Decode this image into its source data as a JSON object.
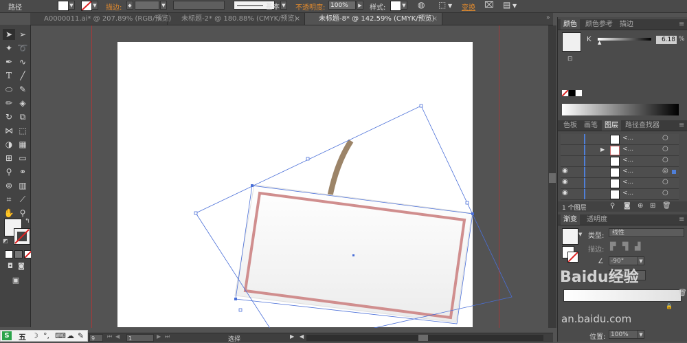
{
  "control_bar": {
    "object_type": "路径",
    "stroke_label": "描边:",
    "stroke_profile": "基本",
    "opacity_label": "不透明度:",
    "opacity_value": "100%",
    "style_label": "样式:",
    "transform_label": "变换"
  },
  "tabs": [
    {
      "label": "A0000011.ai* @ 207.89% (RGB/预览)",
      "close": "×"
    },
    {
      "label": "未标题-2* @ 180.88% (CMYK/预览)",
      "close": "×"
    },
    {
      "label": "未标题-8* @ 142.59% (CMYK/预览)",
      "close": "×"
    }
  ],
  "color_panel": {
    "tabs": [
      "颜色",
      "颜色参考",
      "描边"
    ],
    "channel_label": "K",
    "channel_value": "6.18",
    "unit": "%"
  },
  "layers_panel": {
    "tabs": [
      "色板",
      "画笔",
      "图层",
      "路径查找器"
    ],
    "rows": [
      {
        "name": "<...",
        "visible": false,
        "expand": ""
      },
      {
        "name": "<...",
        "visible": false,
        "expand": "▶"
      },
      {
        "name": "<...",
        "visible": false,
        "expand": ""
      },
      {
        "name": "<...",
        "visible": true,
        "expand": ""
      },
      {
        "name": "<...",
        "visible": true,
        "expand": ""
      },
      {
        "name": "<...",
        "visible": true,
        "expand": ""
      }
    ],
    "footer": "1 个图层"
  },
  "gradient_panel": {
    "tabs": [
      "渐变",
      "透明度"
    ],
    "type_label": "类型:",
    "type_value": "线性",
    "stroke_label": "描边:",
    "angle_value": "-90°",
    "location_label": "位置:",
    "location_value": "100%"
  },
  "statusbar": {
    "zoom": "9",
    "page": "1",
    "tool_label": "选择"
  },
  "ime": {
    "logo": "S",
    "items": [
      "五",
      "☽",
      "°,",
      "⌨",
      "☁",
      "✎"
    ]
  },
  "watermark": {
    "line1": "Baidu经验",
    "line2": "an.baidu.com"
  },
  "colors": {
    "label_stroke": "#d08e8e",
    "stem": "#9c8468",
    "selection": "#4a6fd8",
    "guide": "#a33a3a"
  }
}
